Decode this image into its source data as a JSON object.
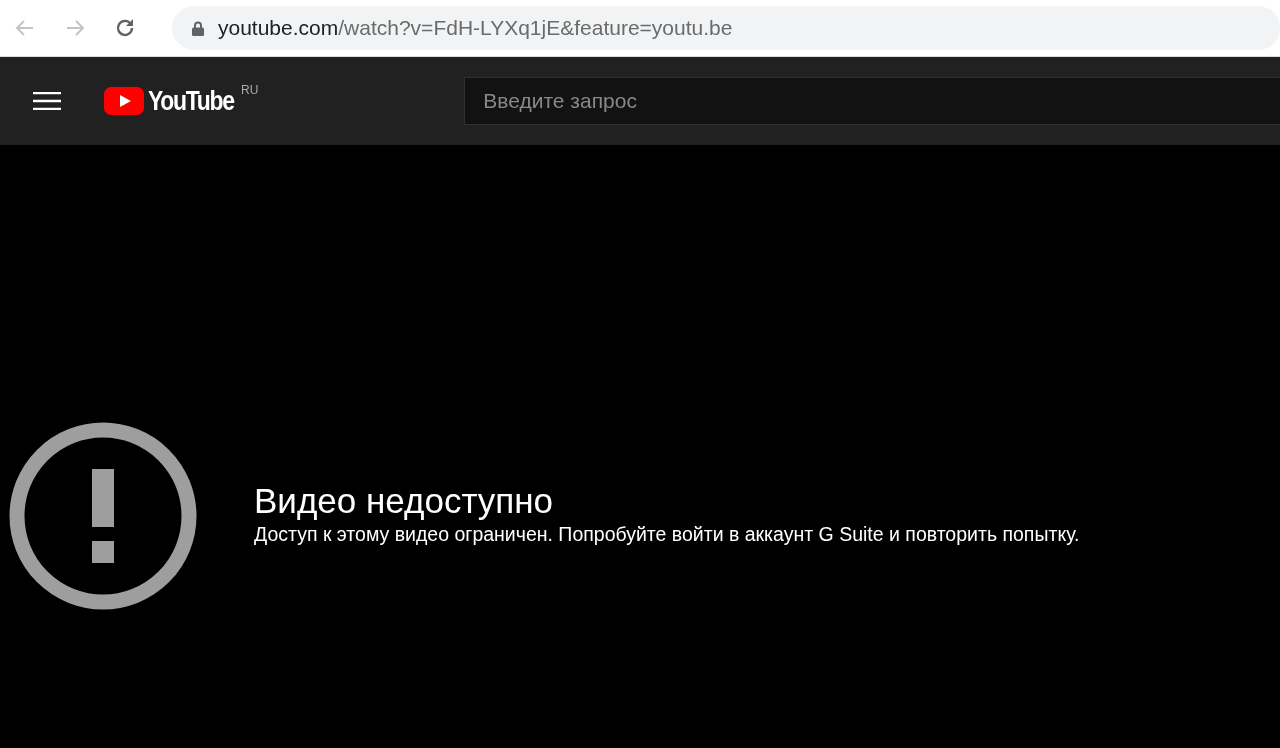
{
  "browser": {
    "url": {
      "host": "youtube.com",
      "path": "/watch?v=FdH-LYXq1jE&feature=youtu.be"
    }
  },
  "header": {
    "logo_text": "YouTube",
    "region": "RU",
    "search": {
      "placeholder": "Введите запрос"
    }
  },
  "player": {
    "error_title": "Видео недоступно",
    "error_message": "Доступ к этому видео ограничен. Попробуйте войти в аккаунт G Suite и повторить попытку."
  }
}
